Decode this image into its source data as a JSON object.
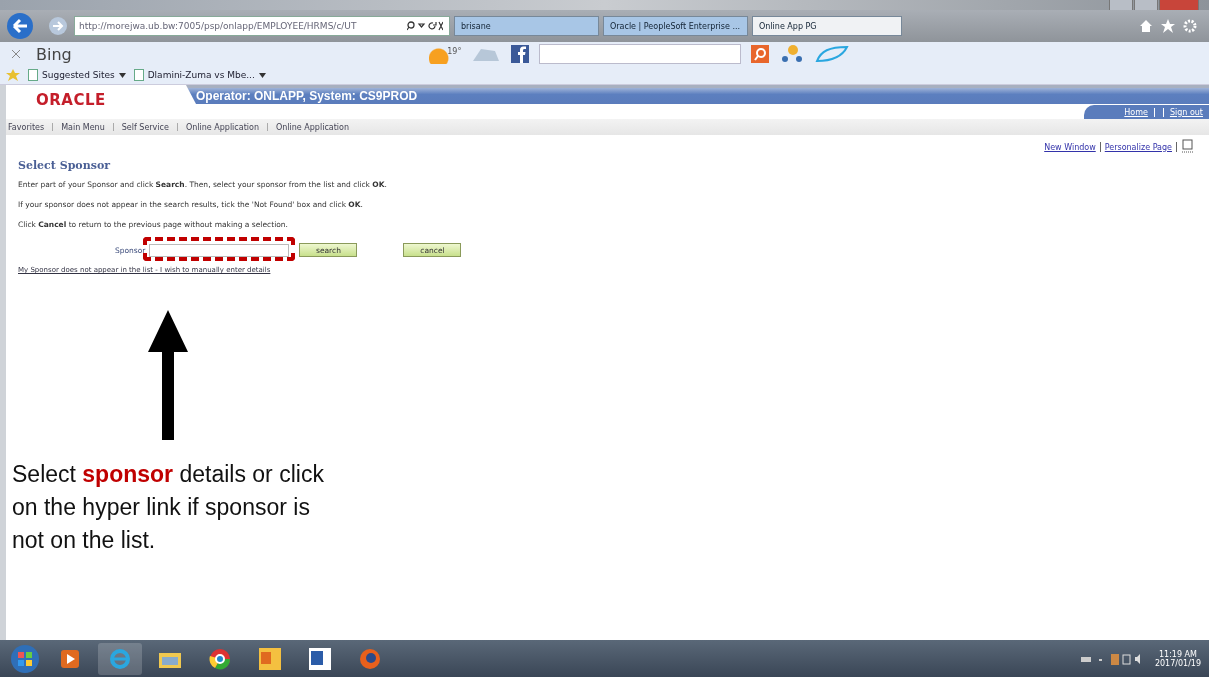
{
  "browser": {
    "address": "http://morejwa.ub.bw:7005/psp/onlapp/EMPLOYEE/HRMS/c/UT",
    "tabs": [
      {
        "label": "brisane",
        "selected": false
      },
      {
        "label": "Oracle | PeopleSoft Enterprise ...",
        "selected": false
      },
      {
        "label": "Online App PG",
        "selected": true
      }
    ],
    "bing_bar": {
      "brand": "Bing",
      "temperature": "19°"
    },
    "favorites": [
      {
        "label": "Suggested Sites"
      },
      {
        "label": "Dlamini-Zuma vs Mbe..."
      }
    ]
  },
  "page": {
    "logo": "ORACLE",
    "operator": "Operator: ONLAPP, System: CS9PROD",
    "header_links": [
      "Home",
      "Sign out"
    ],
    "breadcrumbs": [
      "Favorites",
      "Main Menu",
      "Self Service",
      "Online Application",
      "Online Application"
    ],
    "page_links": [
      "New Window",
      "Personalize Page"
    ],
    "title": "Select Sponsor",
    "instructions": [
      "Enter part of your Sponsor and click **Search**. Then, select your sponsor from the list and click **OK**.",
      "If your sponsor does not appear in the search results, tick the 'Not Found' box and click **OK**.",
      "Click **Cancel** to return to the previous page without making a selection."
    ],
    "sponsor_field": {
      "label": "Sponsor"
    },
    "buttons": [
      "search",
      "cancel"
    ],
    "manual_link": "My Sponsor does not appear in the list - I wish to manually enter details"
  },
  "annotation": {
    "lines": [
      "Select **sponsor** details or click",
      "on the hyper link if sponsor is",
      "not on the list."
    ]
  },
  "taskbar": {
    "time": "11:19 AM",
    "date": "2017/01/19"
  }
}
